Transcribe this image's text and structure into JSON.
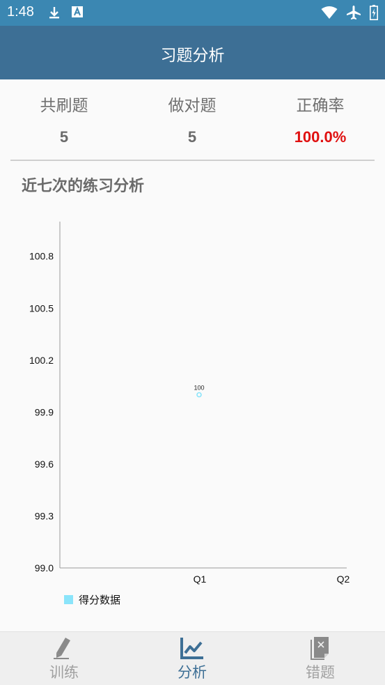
{
  "status_bar": {
    "time": "1:48",
    "icons_left": [
      "download-icon",
      "a-notification-icon"
    ],
    "icons_right": [
      "wifi-icon",
      "airplane-icon",
      "battery-icon"
    ]
  },
  "header": {
    "title": "习题分析"
  },
  "stats": [
    {
      "label": "共刷题",
      "value": "5"
    },
    {
      "label": "做对题",
      "value": "5"
    },
    {
      "label": "正确率",
      "value": "100.0%",
      "color": "#e01010"
    }
  ],
  "section_title": "近七次的练习分析",
  "chart_data": {
    "type": "line",
    "categories": [
      "Q1",
      "Q2"
    ],
    "series": [
      {
        "name": "得分数据",
        "values": [
          100,
          null
        ],
        "color": "#8ae4fa",
        "data_labels": [
          "100",
          ""
        ]
      }
    ],
    "yticks": [
      "99.0",
      "99.3",
      "99.6",
      "99.9",
      "100.2",
      "100.5",
      "100.8"
    ],
    "ylim": [
      99.0,
      101.0
    ],
    "grid": false,
    "legend_position": "bottom-left"
  },
  "legend": {
    "label": "得分数据"
  },
  "bottom_nav": {
    "active": "分析",
    "items": [
      {
        "label": "训练",
        "icon": "pencil-icon"
      },
      {
        "label": "分析",
        "icon": "line-chart-icon"
      },
      {
        "label": "错题",
        "icon": "wrong-note-icon"
      }
    ]
  },
  "colors": {
    "status_bar": "#3b87b2",
    "app_bar": "#3d6f95",
    "accent": "#3d6f95",
    "danger": "#e01010"
  }
}
